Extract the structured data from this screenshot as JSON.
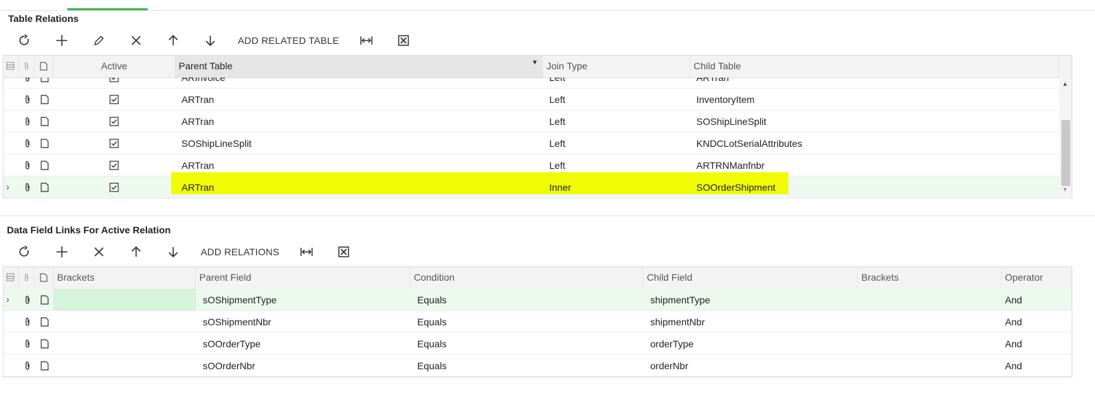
{
  "colors": {
    "accent": "#3fb44a",
    "highlight": "#f2fb06",
    "selected_row": "#edf8ef"
  },
  "relations": {
    "title": "Table Relations",
    "toolbar": {
      "refresh_icon": "refresh-icon",
      "add_icon": "plus-icon",
      "edit_icon": "pencil-icon",
      "delete_icon": "x-icon",
      "up_icon": "arrow-up-icon",
      "down_icon": "arrow-down-icon",
      "add_related_label": "ADD RELATED TABLE",
      "fit_icon": "fit-columns-icon",
      "export_icon": "excel-export-icon"
    },
    "columns": {
      "active": "Active",
      "parent": "Parent Table",
      "join": "Join Type",
      "child": "Child Table"
    },
    "partial_row": {
      "parent": "ARInvoice",
      "join": "Left",
      "child": "ARTran"
    },
    "rows": [
      {
        "active": true,
        "parent": "ARTran",
        "join": "Left",
        "child": "InventoryItem"
      },
      {
        "active": true,
        "parent": "ARTran",
        "join": "Left",
        "child": "SOShipLineSplit"
      },
      {
        "active": true,
        "parent": "SOShipLineSplit",
        "join": "Left",
        "child": "KNDCLotSerialAttributes"
      },
      {
        "active": true,
        "parent": "ARTran",
        "join": "Left",
        "child": "ARTRNManfnbr"
      },
      {
        "active": true,
        "parent": "ARTran",
        "join": "Inner",
        "child": "SOOrderShipment",
        "selected": true
      }
    ]
  },
  "links": {
    "title": "Data Field Links For Active Relation",
    "toolbar": {
      "add_relations_label": "ADD RELATIONS"
    },
    "columns": {
      "brackets_open": "Brackets",
      "parent": "Parent Field",
      "condition": "Condition",
      "child": "Child Field",
      "brackets_close": "Brackets",
      "operator": "Operator"
    },
    "rows": [
      {
        "parent": "sOShipmentType",
        "condition": "Equals",
        "child": "shipmentType",
        "operator": "And",
        "selected": true
      },
      {
        "parent": "sOShipmentNbr",
        "condition": "Equals",
        "child": "shipmentNbr",
        "operator": "And"
      },
      {
        "parent": "sOOrderType",
        "condition": "Equals",
        "child": "orderType",
        "operator": "And"
      },
      {
        "parent": "sOOrderNbr",
        "condition": "Equals",
        "child": "orderNbr",
        "operator": "And"
      }
    ]
  }
}
